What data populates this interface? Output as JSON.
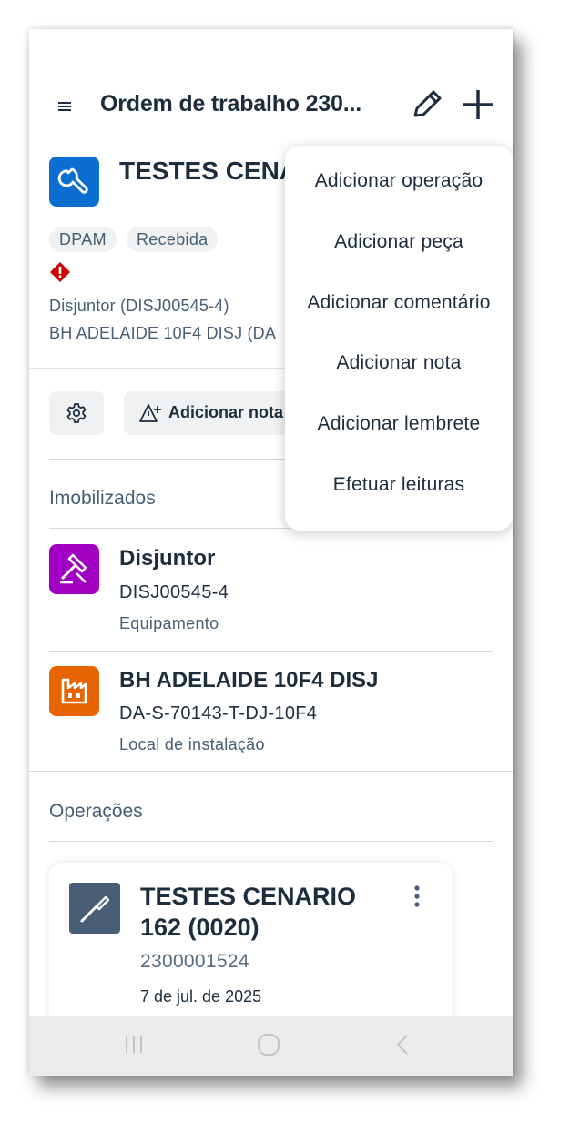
{
  "header": {
    "title": "Ordem de trabalho 230..."
  },
  "work_order": {
    "title": "TESTES CENA 162",
    "tags": [
      "DPAM",
      "Recebida"
    ],
    "equipment_line": "Disjuntor (DISJ00545-4)",
    "location_line": "BH ADELAIDE 10F4 DISJ (DA"
  },
  "toolbar": {
    "add_note_label": "Adicionar nota"
  },
  "assets": {
    "section_title": "Imobilizados",
    "items": [
      {
        "title": "Disjuntor",
        "id": "DISJ00545-4",
        "type": "Equipamento",
        "color": "#a100c2"
      },
      {
        "title": "BH ADELAIDE 10F4 DISJ",
        "id": "DA-S-70143-T-DJ-10F4",
        "type": "Local de instalação",
        "color": "#e76500"
      }
    ]
  },
  "operations": {
    "section_title": "Operações",
    "card": {
      "title": "TESTES CENARIO 162 (0020)",
      "number": "2300001524",
      "date": "7 de jul. de 2025"
    }
  },
  "popup_menu": {
    "items": [
      "Adicionar operação",
      "Adicionar peça",
      "Adicionar comentário",
      "Adicionar nota",
      "Adicionar lembrete",
      "Efetuar leituras"
    ]
  },
  "colors": {
    "primary": "#0a6ed1",
    "priority": "#cc0000",
    "text": "#1d2d3e",
    "muted": "#475e75"
  }
}
